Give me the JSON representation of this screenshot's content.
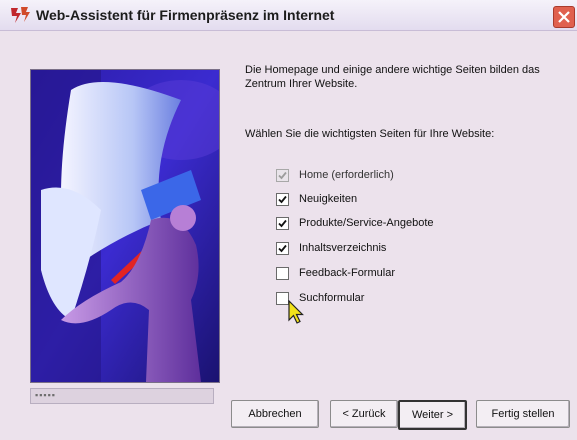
{
  "window": {
    "title": "Web-Assistent für Firmenpräsenz im Internet"
  },
  "intro": {
    "description_1": "Die Homepage und einige andere wichtige Seiten bilden das Zentrum Ihrer Website.",
    "description_2": "Wählen Sie die wichtigsten Seiten für Ihre Website:"
  },
  "pages": [
    {
      "label": "Home (erforderlich)",
      "checked": true,
      "disabled": true
    },
    {
      "label": "Neuigkeiten",
      "checked": true,
      "disabled": false
    },
    {
      "label": "Produkte/Service-Angebote",
      "checked": true,
      "disabled": false
    },
    {
      "label": "Inhaltsverzeichnis",
      "checked": true,
      "disabled": false
    },
    {
      "label": "Feedback-Formular",
      "checked": false,
      "disabled": false
    },
    {
      "label": "Suchformular",
      "checked": false,
      "disabled": false
    }
  ],
  "buttons": {
    "cancel": "Abbrechen",
    "back": "< Zurück",
    "next": "Weiter >",
    "finish": "Fertig stellen"
  },
  "colors": {
    "dialog_bg": "#ece2ec",
    "close_button": "#e0604e",
    "illustration_blue": "#2a1f9c"
  },
  "icons": {
    "app": "wizard-app-icon",
    "close": "close-icon",
    "checkmark": "checkmark-icon",
    "cursor": "mouse-pointer-icon"
  }
}
